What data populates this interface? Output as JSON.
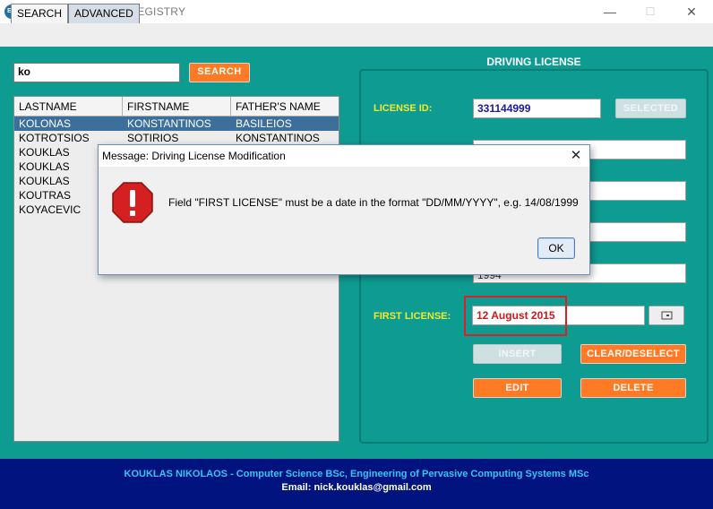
{
  "window": {
    "app_icon_text": "EK",
    "title": "DRIVING LICENSES REGISTRY",
    "minimize_glyph": "—",
    "maximize_glyph": "☐",
    "close_glyph": "✕"
  },
  "tabs": [
    {
      "label": "SEARCH",
      "selected": false
    },
    {
      "label": "ADVANCED",
      "selected": true
    }
  ],
  "search": {
    "value": "ko",
    "button_label": "SEARCH"
  },
  "table": {
    "columns": [
      "LASTNAME",
      "FIRSTNAME",
      "FATHER'S NAME"
    ],
    "rows": [
      {
        "lastname": "KOLONAS",
        "firstname": "KONSTANTINOS",
        "father": "BASILEIOS",
        "selected": true
      },
      {
        "lastname": "KOTROTSIOS",
        "firstname": "SOTIRIOS",
        "father": "KONSTANTINOS",
        "selected": false
      },
      {
        "lastname": "KOUKLAS",
        "firstname": "",
        "father": "",
        "selected": false
      },
      {
        "lastname": "KOUKLAS",
        "firstname": "",
        "father": "",
        "selected": false
      },
      {
        "lastname": "KOUKLAS",
        "firstname": "",
        "father": "",
        "selected": false
      },
      {
        "lastname": "KOUTRAS",
        "firstname": "",
        "father": "",
        "selected": false
      },
      {
        "lastname": "KOYACEVIC",
        "firstname": "",
        "father": "",
        "selected": false
      }
    ]
  },
  "license_panel": {
    "title": "DRIVING LICENSE",
    "license_id_label": "LICENSE ID:",
    "license_id_value": "331144999",
    "selected_button": "SELECTED",
    "birth_year_value": "1994",
    "first_license_label": "FIRST LICENSE:",
    "first_license_value": "12 August 2015",
    "calendar_icon": "calendar-icon",
    "insert_button": "INSERT",
    "clear_button": "CLEAR/DESELECT",
    "edit_button": "EDIT",
    "delete_button": "DELETE"
  },
  "dialog": {
    "title": "Message: Driving License Modification",
    "close_glyph": "✕",
    "icon": "error-icon",
    "message": "Field \"FIRST LICENSE\" must be a date in the format \"DD/MM/YYYY\", e.g. 14/08/1999",
    "ok_label": "OK"
  },
  "footer": {
    "line1": "KOUKLAS NIKOLAOS - Computer Science BSc, Engineering of Pervasive Computing Systems MSc",
    "line2": "Email: nick.kouklas@gmail.com"
  },
  "colors": {
    "background": "#0e9c92",
    "accent_orange": "#ff7a24",
    "label_yellow": "#f2ea2c",
    "footer_blue": "#00137f",
    "error_red": "#e02020"
  }
}
